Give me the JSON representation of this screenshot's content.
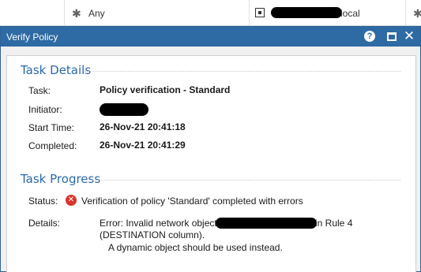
{
  "background_row": {
    "col1_icon": "asterisk",
    "col2_icon": "asterisk",
    "col2_text": "Any",
    "col3_icon": "network-object-icon",
    "col3_suffix": "local",
    "col4_icon": "asterisk"
  },
  "dialog": {
    "title": "Verify Policy",
    "help_glyph": "?",
    "close_glyph": "✕"
  },
  "task_details": {
    "heading": "Task Details",
    "task_label": "Task:",
    "task_value": "Policy verification - Standard",
    "initiator_label": "Initiator:",
    "start_label": "Start Time:",
    "start_value": "26-Nov-21 20:41:18",
    "completed_label": "Completed:",
    "completed_value": "26-Nov-21 20:41:29"
  },
  "task_progress": {
    "heading": "Task Progress",
    "status_label": "Status:",
    "status_icon": "error-icon",
    "status_icon_glyph": "✕",
    "status_text": "Verification of policy 'Standard' completed with errors",
    "details_label": "Details:",
    "details_line1_prefix": "Error: Invalid network object",
    "details_line1_suffix": "in Rule 4",
    "details_line2": "(DESTINATION column).",
    "details_line3": "A dynamic object should be used instead.",
    "status_color": "#d9342b"
  },
  "colors": {
    "titlebar": "#2e6aa3",
    "section_heading": "#2a6aaa"
  }
}
